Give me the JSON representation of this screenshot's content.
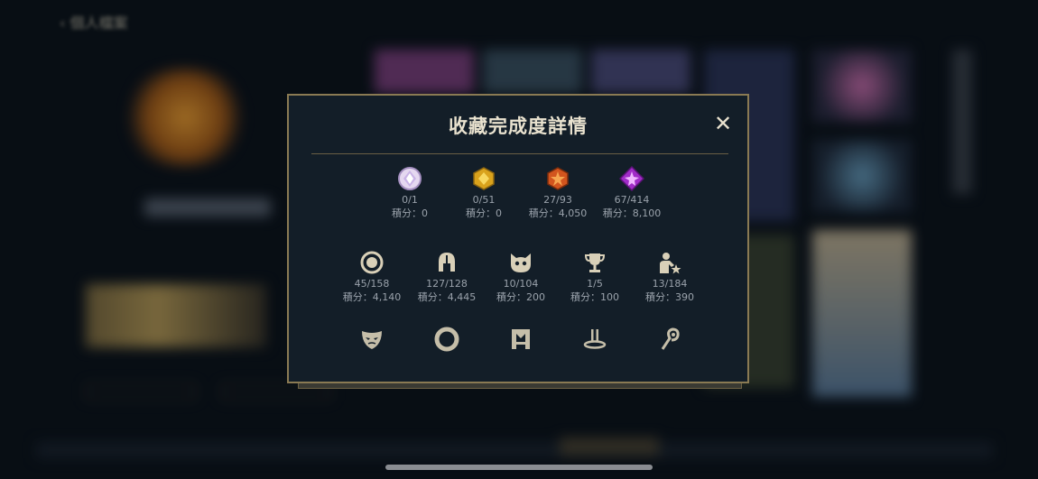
{
  "header": {
    "back_label": "個人檔案"
  },
  "modal": {
    "title": "收藏完成度詳情",
    "close_symbol": "✕",
    "rows": [
      [
        {
          "icon": "white-gem-icon",
          "count": "0/1",
          "points": "積分：0"
        },
        {
          "icon": "gold-gem-icon",
          "count": "0/51",
          "points": "積分：0"
        },
        {
          "icon": "orange-star-gem-icon",
          "count": "27/93",
          "points": "積分：4,050"
        },
        {
          "icon": "purple-star-gem-icon",
          "count": "67/414",
          "points": "積分：8,100"
        }
      ],
      [
        {
          "icon": "ring-icon",
          "count": "45/158",
          "points": "積分：4,140"
        },
        {
          "icon": "helmet-icon",
          "count": "127/128",
          "points": "積分：4,445"
        },
        {
          "icon": "cat-face-icon",
          "count": "10/104",
          "points": "積分：200"
        },
        {
          "icon": "trophy-icon",
          "count": "1/5",
          "points": "積分：100"
        },
        {
          "icon": "person-star-icon",
          "count": "13/184",
          "points": "積分：390"
        }
      ],
      [
        {
          "icon": "mask-icon"
        },
        {
          "icon": "circle-frame-icon"
        },
        {
          "icon": "banner-icon"
        },
        {
          "icon": "pedestal-icon"
        },
        {
          "icon": "hook-icon"
        }
      ]
    ]
  },
  "colors": {
    "accent_gold": "#8a7a53",
    "panel_bg": "#131e28",
    "text_light": "#e9e2cf",
    "text_muted": "#9aa2ab"
  }
}
